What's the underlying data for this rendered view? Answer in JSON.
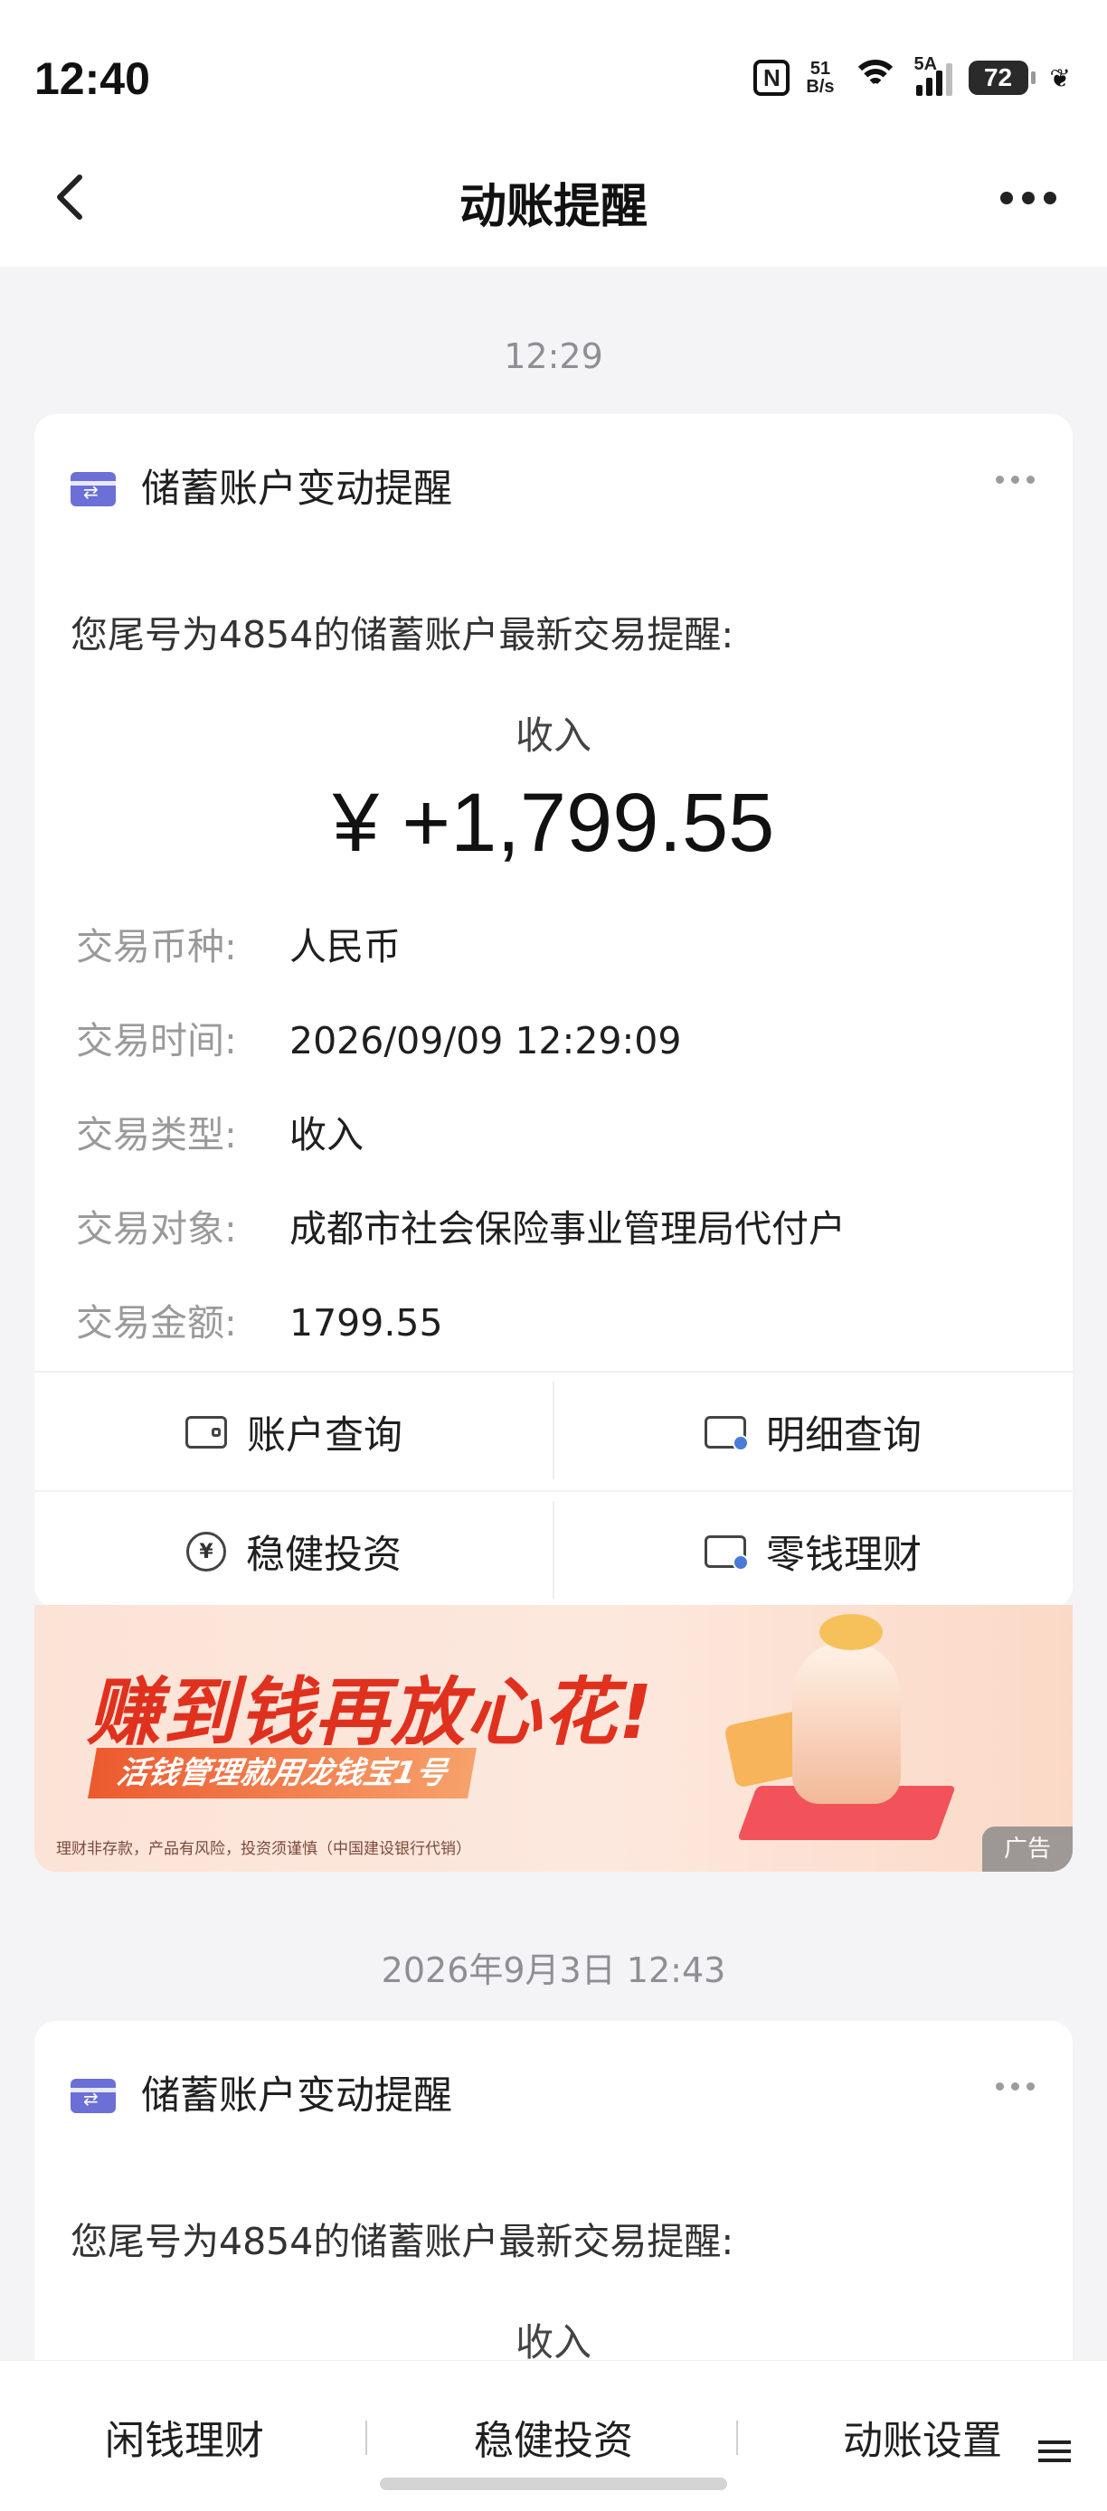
{
  "status_bar": {
    "time": "12:40",
    "nfc": "N",
    "net_speed_top": "51",
    "net_speed_bottom": "B/s",
    "signal_label": "5A",
    "battery": "72"
  },
  "nav": {
    "title": "动账提醒"
  },
  "feed": [
    {
      "timestamp": "12:29",
      "card": {
        "title": "储蓄账户变动提醒",
        "description": "您尾号为4854的储蓄账户最新交易提醒:",
        "type_label": "收入",
        "amount": "¥ +1,799.55",
        "details": [
          {
            "key": "交易币种:",
            "value": "人民币"
          },
          {
            "key": "交易时间:",
            "value": "2026/09/09 12:29:09"
          },
          {
            "key": "交易类型:",
            "value": "收入"
          },
          {
            "key": "交易对象:",
            "value": "成都市社会保险事业管理局代付户"
          },
          {
            "key": "交易金额:",
            "value": "1799.55"
          }
        ],
        "actions": [
          {
            "label": "账户查询",
            "icon": "wallet-icon"
          },
          {
            "label": "明细查询",
            "icon": "statement-icon"
          },
          {
            "label": "稳健投资",
            "icon": "yuan-chart-icon"
          },
          {
            "label": "零钱理财",
            "icon": "change-finance-icon"
          }
        ]
      }
    },
    {
      "timestamp": "2026年9月3日 12:43",
      "card": {
        "title": "储蓄账户变动提醒",
        "description": "您尾号为4854的储蓄账户最新交易提醒:",
        "type_label": "收入"
      }
    }
  ],
  "banner": {
    "slogan": "赚到钱再放心花!",
    "subtitle": "活钱管理就用龙钱宝1号",
    "disclaimer": "理财非存款，产品有风险，投资须谨慎（中国建设银行代销）",
    "ad_label": "广告",
    "colors": {
      "slogan": "#e0311f",
      "background": "#fbe3d6"
    }
  },
  "bottom_tabs": [
    "闲钱理财",
    "稳健投资",
    "动账设置"
  ]
}
